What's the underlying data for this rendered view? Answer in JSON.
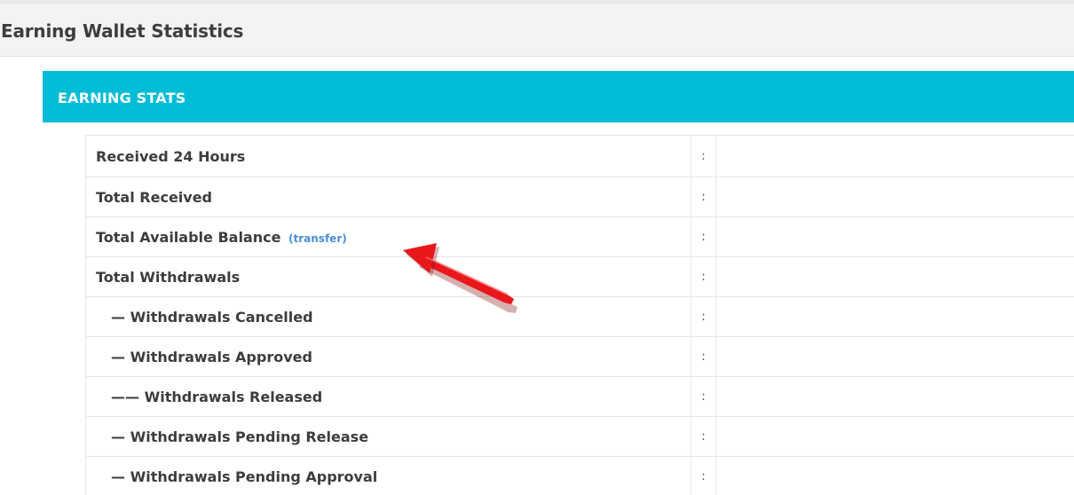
{
  "page": {
    "title": "Earning Wallet Statistics"
  },
  "panel": {
    "title": "EARNING STATS",
    "accent_color": "#00bcd4"
  },
  "rows": [
    {
      "label": "Received 24 Hours",
      "separator": ":",
      "value": ""
    },
    {
      "label": "Total Received",
      "separator": ":",
      "value": ""
    },
    {
      "label": "Total Available Balance",
      "separator": ":",
      "value": "",
      "link": "(transfer)"
    },
    {
      "label": "Total Withdrawals",
      "separator": ":",
      "value": ""
    },
    {
      "label": "— Withdrawals Cancelled",
      "separator": ":",
      "value": ""
    },
    {
      "label": "— Withdrawals Approved",
      "separator": ":",
      "value": ""
    },
    {
      "label": "—— Withdrawals Released",
      "separator": ":",
      "value": ""
    },
    {
      "label": "— Withdrawals Pending Release",
      "separator": ":",
      "value": ""
    },
    {
      "label": "— Withdrawals Pending Approval",
      "separator": ":",
      "value": ""
    }
  ],
  "annotation": {
    "icon": "red-arrow-icon",
    "color": "#e8171c"
  }
}
